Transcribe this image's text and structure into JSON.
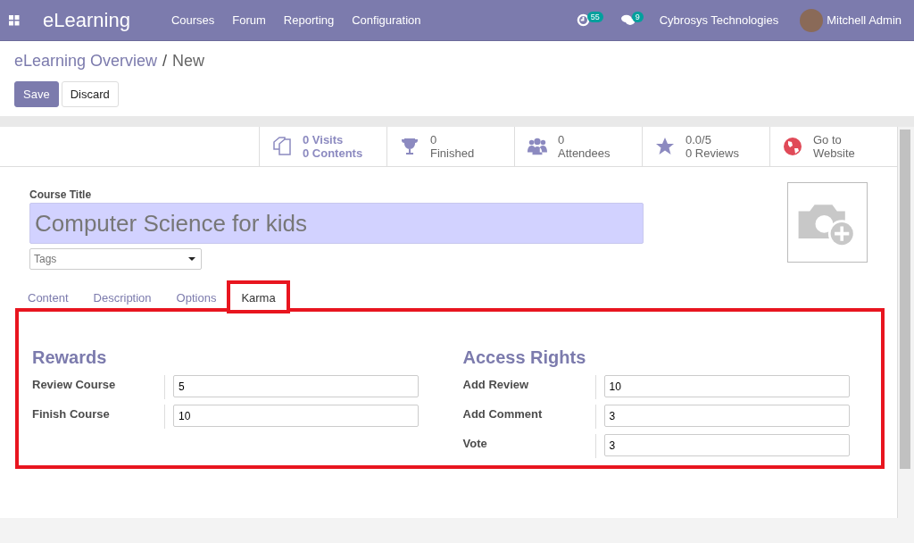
{
  "navbar": {
    "app_name": "eLearning",
    "menu": [
      "Courses",
      "Forum",
      "Reporting",
      "Configuration"
    ],
    "activity_count": "55",
    "message_count": "9",
    "company": "Cybrosys Technologies",
    "user": "Mitchell Admin"
  },
  "breadcrumb": {
    "parent": "eLearning Overview",
    "separator": "/",
    "current": "New"
  },
  "buttons": [
    {
      "label": "Save",
      "kind": "primary"
    },
    {
      "label": "Discard",
      "kind": "secondary"
    }
  ],
  "stat_buttons": [
    {
      "kind": "contents",
      "line1": "0 Visits",
      "line2": "0 Contents",
      "accent": true
    },
    {
      "kind": "finished",
      "line1": "0",
      "line2": "Finished",
      "accent": false
    },
    {
      "kind": "attendees",
      "line1": "0",
      "line2": "Attendees",
      "accent": false
    },
    {
      "kind": "reviews",
      "line1": "0.0/5",
      "line2": "0 Reviews",
      "accent": false
    },
    {
      "kind": "website",
      "line1": "Go to",
      "line2": "Website",
      "accent": false
    }
  ],
  "form": {
    "title_label": "Course Title",
    "title_value": "Computer Science for kids",
    "tags_placeholder": "Tags"
  },
  "tabs": [
    {
      "label": "Content",
      "selected": false,
      "highlighted": false
    },
    {
      "label": "Description",
      "selected": false,
      "highlighted": false
    },
    {
      "label": "Options",
      "selected": false,
      "highlighted": false
    },
    {
      "label": "Karma",
      "selected": true,
      "highlighted": true
    }
  ],
  "karma": {
    "highlighted": true,
    "groups": [
      {
        "title": "Rewards",
        "fields": [
          {
            "label": "Review Course",
            "value": "5"
          },
          {
            "label": "Finish Course",
            "value": "10"
          }
        ]
      },
      {
        "title": "Access Rights",
        "fields": [
          {
            "label": "Add Review",
            "value": "10"
          },
          {
            "label": "Add Comment",
            "value": "3"
          },
          {
            "label": "Vote",
            "value": "3"
          }
        ]
      }
    ]
  }
}
